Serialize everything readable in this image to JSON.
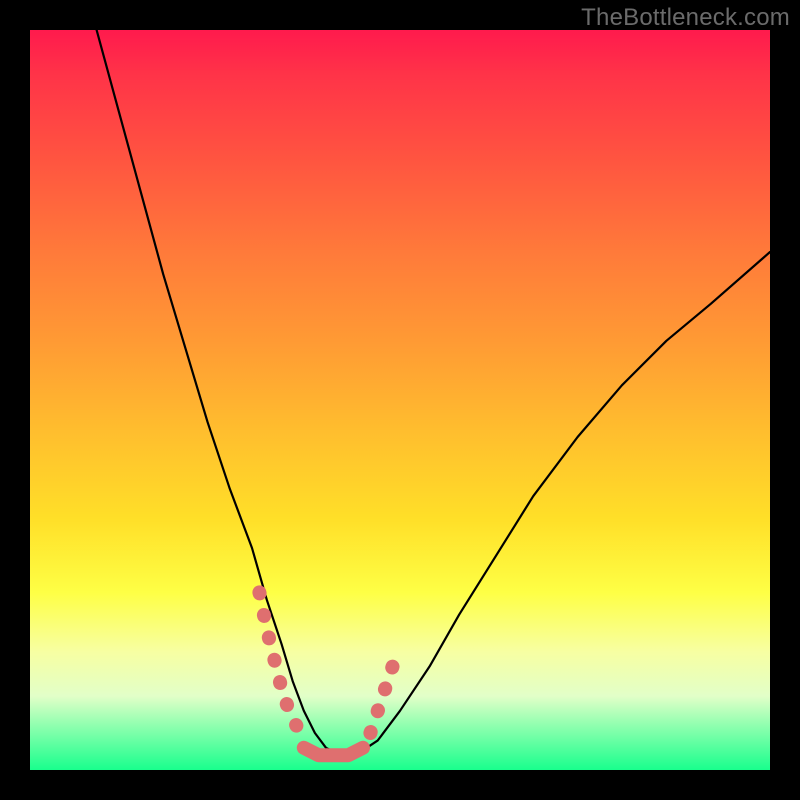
{
  "watermark": "TheBottleneck.com",
  "chart_data": {
    "type": "line",
    "title": "",
    "xlabel": "",
    "ylabel": "",
    "xlim": [
      0,
      100
    ],
    "ylim": [
      0,
      100
    ],
    "grid": false,
    "legend": false,
    "series": [
      {
        "name": "bottleneck-curve",
        "color": "#000000",
        "x": [
          9,
          12,
          15,
          18,
          21,
          24,
          27,
          30,
          32,
          34,
          35.5,
          37,
          38.5,
          40,
          42,
          44,
          47,
          50,
          54,
          58,
          63,
          68,
          74,
          80,
          86,
          92,
          100
        ],
        "y": [
          100,
          89,
          78,
          67,
          57,
          47,
          38,
          30,
          23,
          17,
          12,
          8,
          5,
          3,
          2,
          2,
          4,
          8,
          14,
          21,
          29,
          37,
          45,
          52,
          58,
          63,
          70
        ]
      },
      {
        "name": "highlight-left-slope",
        "color": "#e07070",
        "x": [
          31,
          32,
          33,
          34,
          35,
          36
        ],
        "y": [
          24,
          19,
          15,
          11,
          8,
          6
        ]
      },
      {
        "name": "highlight-valley-floor",
        "color": "#e07070",
        "x": [
          37,
          39,
          41,
          43,
          45
        ],
        "y": [
          3,
          2,
          2,
          2,
          3
        ]
      },
      {
        "name": "highlight-right-slope",
        "color": "#e07070",
        "x": [
          46,
          47,
          48,
          49
        ],
        "y": [
          5,
          8,
          11,
          14
        ]
      }
    ],
    "background_gradient": {
      "top": "#ff1a4d",
      "mid_upper": "#ff9a34",
      "mid_lower": "#feff45",
      "bottom": "#19ff8d"
    }
  }
}
